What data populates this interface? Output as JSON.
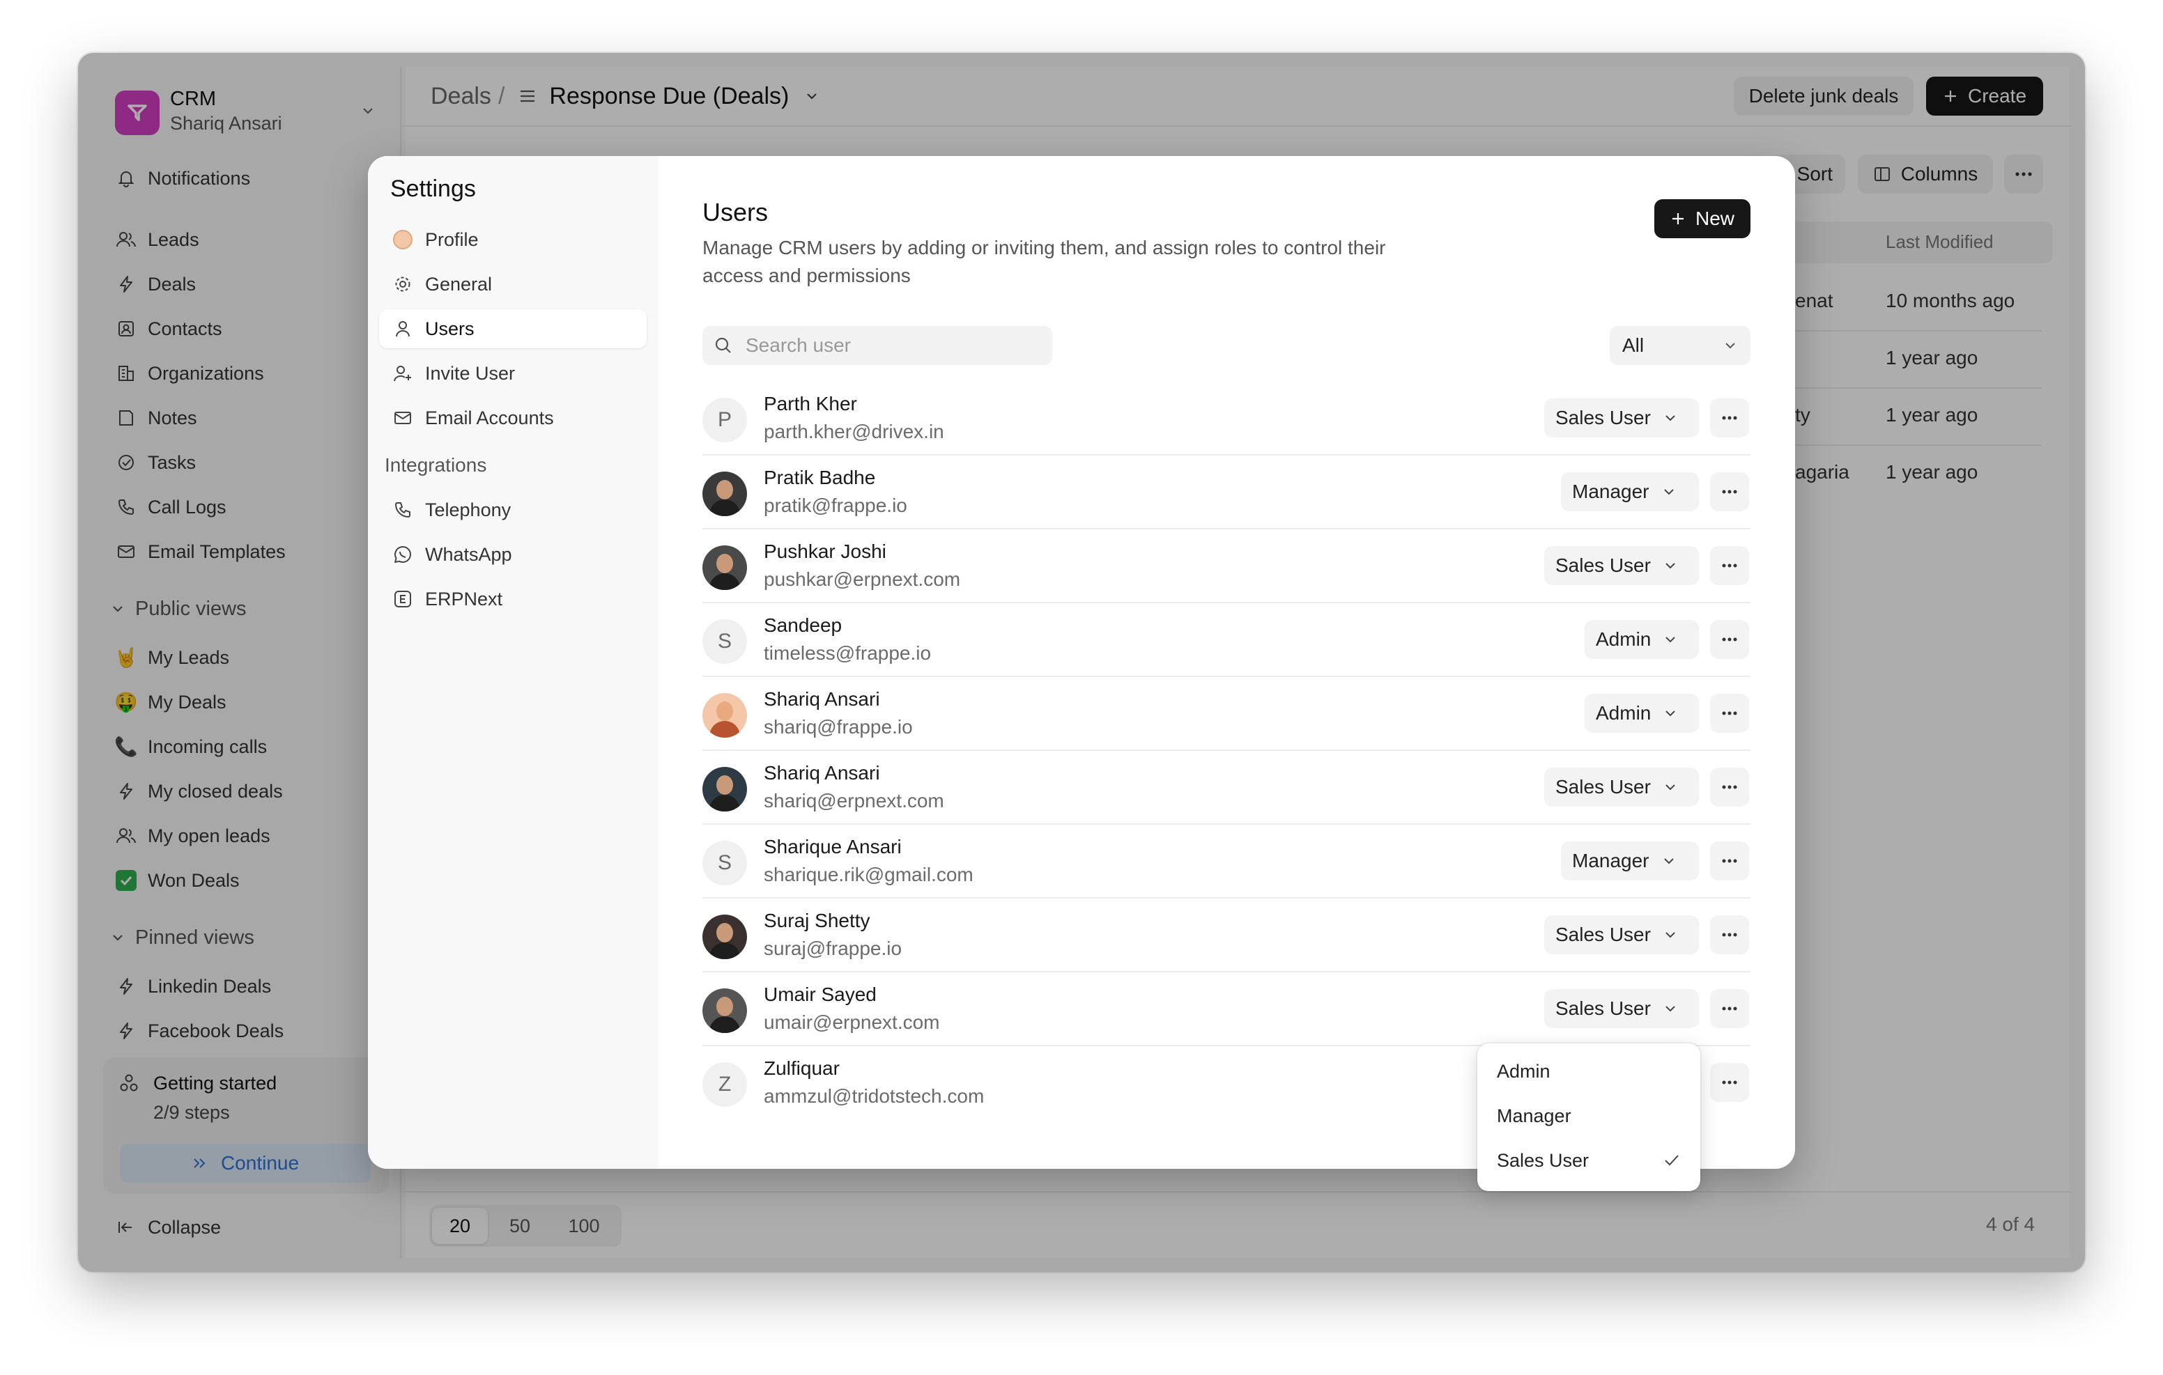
{
  "app": {
    "name": "CRM",
    "user": "Shariq Ansari"
  },
  "sidebar": {
    "notifications": "Notifications",
    "items": [
      {
        "label": "Leads",
        "icon": "users-icon"
      },
      {
        "label": "Deals",
        "icon": "lightning-icon"
      },
      {
        "label": "Contacts",
        "icon": "contact-card-icon"
      },
      {
        "label": "Organizations",
        "icon": "building-icon"
      },
      {
        "label": "Notes",
        "icon": "note-icon"
      },
      {
        "label": "Tasks",
        "icon": "check-circle-icon"
      },
      {
        "label": "Call Logs",
        "icon": "phone-icon"
      },
      {
        "label": "Email Templates",
        "icon": "mail-icon"
      }
    ],
    "public_views_label": "Public views",
    "public_views": [
      {
        "label": "My Leads",
        "emoji": "🤘"
      },
      {
        "label": "My Deals",
        "emoji": "🤑"
      },
      {
        "label": "Incoming calls",
        "emoji": "📞"
      },
      {
        "label": "My closed deals",
        "icon": "lightning-icon"
      },
      {
        "label": "My open leads",
        "icon": "users-icon"
      },
      {
        "label": "Won Deals",
        "emoji": "✅"
      }
    ],
    "pinned_views_label": "Pinned views",
    "pinned_views": [
      {
        "label": "Linkedin Deals",
        "icon": "lightning-icon"
      },
      {
        "label": "Facebook Deals",
        "icon": "lightning-icon"
      }
    ],
    "getting_started": {
      "title": "Getting started",
      "steps": "2/9 steps",
      "continue": "Continue"
    },
    "collapse": "Collapse"
  },
  "header": {
    "breadcrumb_root": "Deals",
    "breadcrumb_sep": "/",
    "view_title": "Response Due (Deals)",
    "delete_junk": "Delete junk deals",
    "create": "Create"
  },
  "toolbar": {
    "sort": "Sort",
    "columns": "Columns"
  },
  "table": {
    "last_modified_header": "Last Modified",
    "rows": [
      {
        "partial": "enat",
        "modified": "10 months ago"
      },
      {
        "partial": "",
        "modified": "1 year ago"
      },
      {
        "partial": "ty",
        "modified": "1 year ago"
      },
      {
        "partial": "agaria",
        "modified": "1 year ago"
      }
    ]
  },
  "pagination": {
    "sizes": [
      "20",
      "50",
      "100"
    ],
    "selected": "20",
    "count": "4 of 4"
  },
  "settings": {
    "title": "Settings",
    "nav": [
      {
        "label": "Profile",
        "icon": "profile-avatar-icon"
      },
      {
        "label": "General",
        "icon": "gear-icon"
      },
      {
        "label": "Users",
        "icon": "user-icon",
        "active": true
      },
      {
        "label": "Invite User",
        "icon": "user-plus-icon"
      },
      {
        "label": "Email Accounts",
        "icon": "mail-icon"
      }
    ],
    "integrations_label": "Integrations",
    "integrations": [
      {
        "label": "Telephony",
        "icon": "phone-icon"
      },
      {
        "label": "WhatsApp",
        "icon": "whatsapp-icon"
      },
      {
        "label": "ERPNext",
        "icon": "erpnext-icon"
      }
    ]
  },
  "users_panel": {
    "title": "Users",
    "description_line1": "Manage CRM users by adding or inviting them, and assign roles to control their",
    "description_line2": "access and permissions",
    "new_button": "New",
    "search_placeholder": "Search user",
    "filter_value": "All",
    "users": [
      {
        "name": "Parth Kher",
        "email": "parth.kher@drivex.in",
        "role": "Sales User",
        "initial": "P",
        "avatar_color": ""
      },
      {
        "name": "Pratik Badhe",
        "email": "pratik@frappe.io",
        "role": "Manager",
        "initial": "",
        "avatar_color": "#3a3a3a"
      },
      {
        "name": "Pushkar Joshi",
        "email": "pushkar@erpnext.com",
        "role": "Sales User",
        "initial": "",
        "avatar_color": "#4a4a4a"
      },
      {
        "name": "Sandeep",
        "email": "timeless@frappe.io",
        "role": "Admin",
        "initial": "S",
        "avatar_color": ""
      },
      {
        "name": "Shariq Ansari",
        "email": "shariq@frappe.io",
        "role": "Admin",
        "initial": "",
        "avatar_color": "#f4c7a8"
      },
      {
        "name": "Shariq Ansari",
        "email": "shariq@erpnext.com",
        "role": "Sales User",
        "initial": "",
        "avatar_color": "#2d3b44"
      },
      {
        "name": "Sharique Ansari",
        "email": "sharique.rik@gmail.com",
        "role": "Manager",
        "initial": "S",
        "avatar_color": ""
      },
      {
        "name": "Suraj Shetty",
        "email": "suraj@frappe.io",
        "role": "Sales User",
        "initial": "",
        "avatar_color": "#3b3030"
      },
      {
        "name": "Umair Sayed",
        "email": "umair@erpnext.com",
        "role": "Sales User",
        "initial": "",
        "avatar_color": "#555555"
      },
      {
        "name": "Zulfiquar",
        "email": "ammzul@tridotstech.com",
        "role": "",
        "initial": "Z",
        "avatar_color": ""
      }
    ]
  },
  "role_dropdown": {
    "options": [
      "Admin",
      "Manager",
      "Sales User"
    ],
    "selected": "Sales User"
  }
}
